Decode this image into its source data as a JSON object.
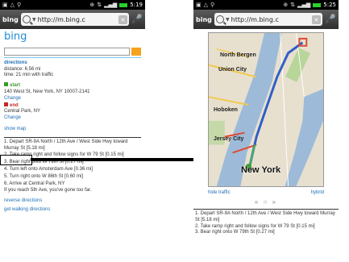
{
  "status": {
    "time_left": "5:19",
    "time_right": "5:25"
  },
  "browser": {
    "tab_label": "bing",
    "url": "http://m.bing.c"
  },
  "left": {
    "logo": "bing",
    "directions_header": "directions",
    "distance": "distance: 6.56 mi",
    "time": "time: 21 min with traffic",
    "start_label": "start",
    "start_address": "140 West St, New York, NY 10007-2141",
    "start_change": "Change",
    "end_label": "end",
    "end_address": "Central Park, NY",
    "end_change": "Change",
    "show_map": "show map",
    "steps": [
      "1. Depart SR-9A North / 12th Ave / West Side Hwy toward Murray St [5.18 mi]",
      "2. Take ramp right and follow signs for W 79 St [0.15 mi]",
      "3. Bear right onto W 79th St [0.27 mi]",
      "4. Turn left onto Amsterdam Ave [0.36 mi]",
      "5. Turn right onto W 86th St [0.60 mi]",
      "6. Arrive at Central Park, NY",
      "If you reach 5th Ave, you've gone too far."
    ],
    "reverse": "reverse directions",
    "walking": "get walking directions"
  },
  "right": {
    "map_labels": {
      "north_bergen": "North Bergen",
      "union_city": "Union City",
      "hoboken": "Hoboken",
      "jersey_city": "Jersey City",
      "new_york": "New York"
    },
    "hide_traffic": "hide traffic",
    "hybrid": "hybrid",
    "pager": "« ○ »",
    "steps": [
      "1. Depart SR-9A North / 12th Ave / West Side Hwy toward Murray St [5.18 mi]",
      "2. Take ramp right and follow signs for W 79 St [0.15 mi]",
      "3. Bear right onto W 79th St [0.27 mi]"
    ]
  }
}
